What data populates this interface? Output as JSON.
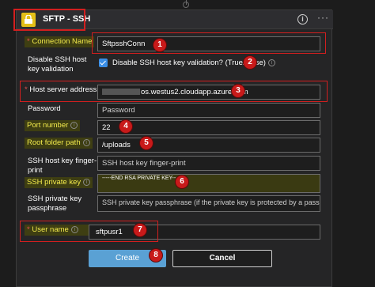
{
  "header": {
    "title": "SFTP - SSH",
    "info_icon": "info-icon",
    "more_icon": "more-icon",
    "more_label": "···"
  },
  "badges": [
    "1",
    "2",
    "3",
    "4",
    "5",
    "6",
    "7",
    "8"
  ],
  "fields": {
    "connection_name": {
      "label": "Connection Name",
      "value": "SftpsshConn",
      "required": true
    },
    "disable_ssh_validation": {
      "label": "Disable SSH host key validation",
      "checkbox_label": "Disable SSH host key validation? (True/False)",
      "checked": true
    },
    "host_server": {
      "label": "Host server address",
      "value": "os.westus2.cloudapp.azure.com",
      "required": true
    },
    "password": {
      "label": "Password",
      "placeholder": "Password"
    },
    "port": {
      "label": "Port number",
      "value": "22"
    },
    "root_folder": {
      "label": "Root folder path",
      "value": "/uploads"
    },
    "fingerprint": {
      "label": "SSH host key finger-print",
      "placeholder": "SSH host key finger-print"
    },
    "private_key": {
      "label": "SSH private key",
      "value": "-----END RSA PRIVATE KEY-----"
    },
    "passphrase": {
      "label": "SSH private key passphrase",
      "placeholder": "SSH private key passphrase (if the private key is protected by a passphrase)"
    },
    "username": {
      "label": "User name",
      "value": "sftpusr1",
      "required": true
    }
  },
  "buttons": {
    "create": "Create",
    "cancel": "Cancel"
  },
  "colors": {
    "accent": "#3a8ee6",
    "highlight_text": "#f2ea4c",
    "annotation_red": "#d21f1f",
    "header_icon": "#e4bf17"
  }
}
